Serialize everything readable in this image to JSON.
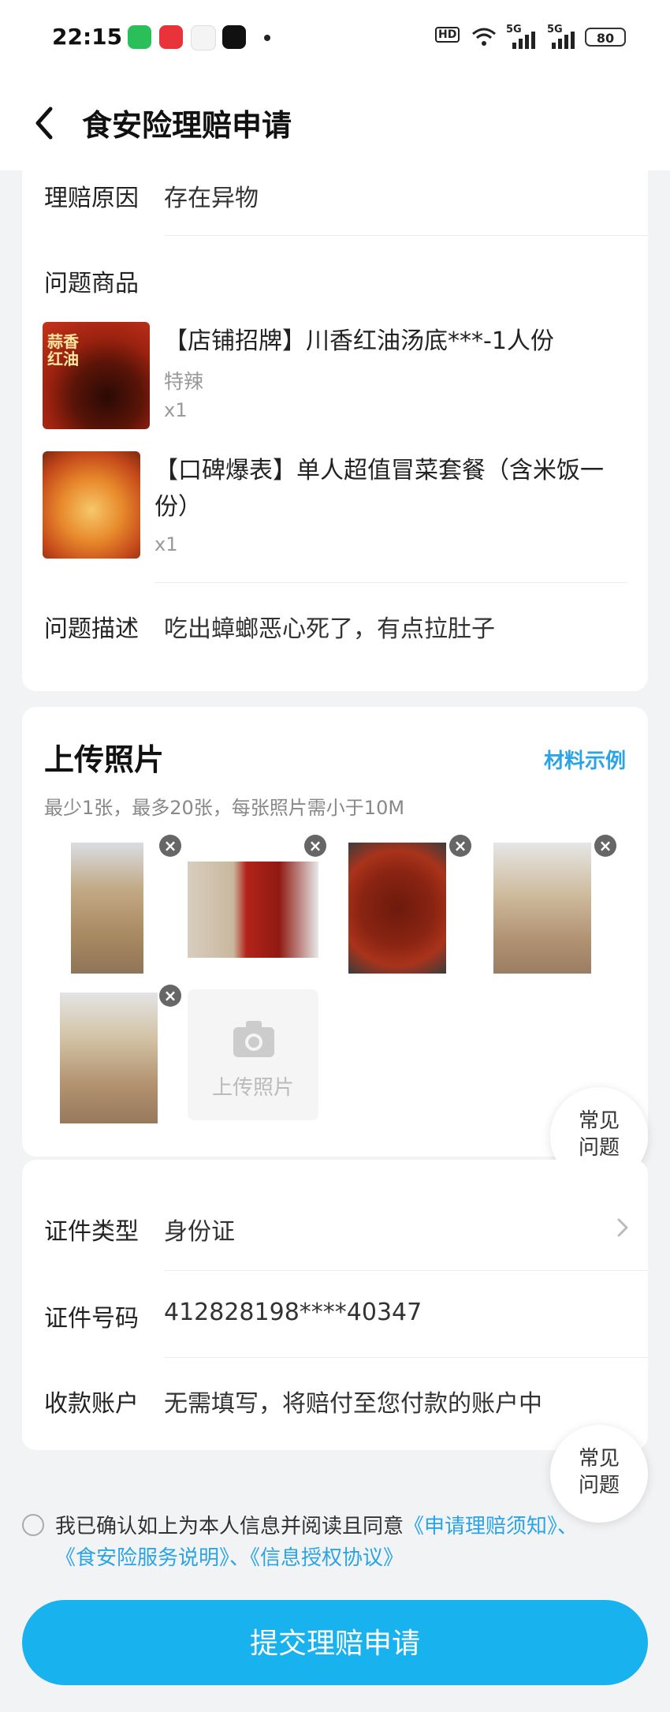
{
  "status_bar": {
    "time": "22:15",
    "hd": "HD",
    "signal1": "5G",
    "signal2": "5G",
    "battery": "80"
  },
  "nav": {
    "title": "食安险理赔申请",
    "back_icon": "chevron-left-icon"
  },
  "claim": {
    "reason_label": "理赔原因",
    "reason_value": "存在异物",
    "products_label": "问题商品",
    "products": [
      {
        "name": "【店铺招牌】川香红油汤底***-1人份",
        "spec": "特辣",
        "qty": "x1",
        "image_text": "蒜香红油"
      },
      {
        "name": "【口碑爆表】单人超值冒菜套餐（含米饭一份）",
        "spec": "",
        "qty": "x1"
      }
    ],
    "desc_label": "问题描述",
    "desc_value": "吃出蟑螂恶心死了，有点拉肚子"
  },
  "upload": {
    "title": "上传照片",
    "example_link": "材料示例",
    "hint": "最少1张，最多20张，每张照片需小于10M",
    "remove_icon": "×",
    "upload_label": "上传照片",
    "camera_icon": "camera-icon",
    "photo_count": 5
  },
  "faq": {
    "line1": "常见",
    "line2": "问题"
  },
  "identity": {
    "id_type_label": "证件类型",
    "id_type_value": "身份证",
    "id_number_label": "证件号码",
    "id_number_value": "412828198****40347",
    "account_label": "收款账户",
    "account_value": "无需填写，将赔付至您付款的账户中"
  },
  "agreement": {
    "prefix": "我已确认如上为本人信息并阅读且同意",
    "link1": "《申请理赔须知》",
    "sep1": "、",
    "link2": "《食安险服务说明》",
    "sep2": "、",
    "link3": "《信息授权协议》"
  },
  "submit_label": "提交理赔申请",
  "colors": {
    "accent": "#18b2ef",
    "link": "#2ba4e6"
  }
}
